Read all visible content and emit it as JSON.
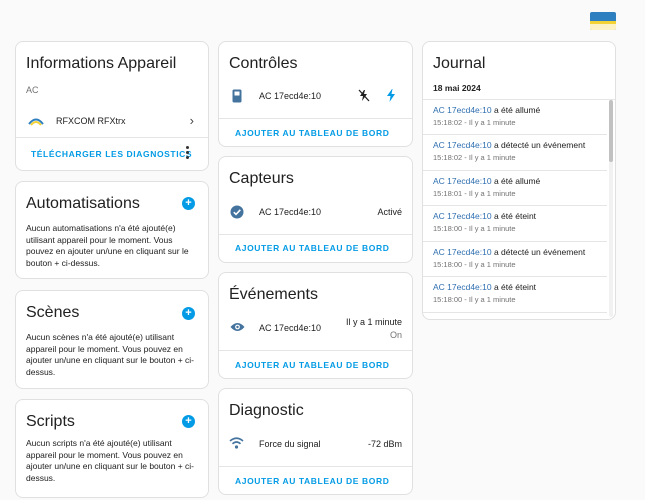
{
  "device_info": {
    "title": "Informations Appareil",
    "subtitle": "AC",
    "integration": "RFXCOM RFXtrx",
    "download_label": "Télécharger les diagnostics"
  },
  "automations": {
    "title": "Automatisations",
    "description": "Aucun automatisations n'a été ajouté(e) utilisant appareil pour le moment. Vous pouvez en ajouter un/une en cliquant sur le bouton + ci-dessus."
  },
  "scenes": {
    "title": "Scènes",
    "description": "Aucun scènes n'a été ajouté(e) utilisant appareil pour le moment. Vous pouvez en ajouter un/une en cliquant sur le bouton + ci-dessus."
  },
  "scripts": {
    "title": "Scripts",
    "description": "Aucun scripts n'a été ajouté(e) utilisant appareil pour le moment. Vous pouvez en ajouter un/une en cliquant sur le bouton + ci-dessus."
  },
  "controls": {
    "title": "Contrôles",
    "entity": "AC 17ecd4e:10",
    "add_label": "Ajouter au tableau de bord"
  },
  "sensors": {
    "title": "Capteurs",
    "entity": "AC 17ecd4e:10",
    "state": "Activé",
    "add_label": "Ajouter au tableau de bord"
  },
  "events": {
    "title": "Événements",
    "entity": "AC 17ecd4e:10",
    "time": "Il y a 1 minute",
    "state": "On",
    "add_label": "Ajouter au tableau de bord"
  },
  "diagnostic": {
    "title": "Diagnostic",
    "entity": "Force du signal",
    "value": "-72 dBm",
    "add_label": "Ajouter au tableau de bord"
  },
  "journal": {
    "title": "Journal",
    "date": "18 mai 2024",
    "entries": [
      {
        "entity": "AC 17ecd4e:10",
        "action": " a été allumé",
        "time": "15:18:02 - Il y a 1 minute"
      },
      {
        "entity": "AC 17ecd4e:10",
        "action": " a détecté un événement",
        "time": "15:18:02 - Il y a 1 minute"
      },
      {
        "entity": "AC 17ecd4e:10",
        "action": " a été allumé",
        "time": "15:18:01 - Il y a 1 minute"
      },
      {
        "entity": "AC 17ecd4e:10",
        "action": " a été éteint",
        "time": "15:18:00 - Il y a 1 minute"
      },
      {
        "entity": "AC 17ecd4e:10",
        "action": " a détecté un événement",
        "time": "15:18:00 - Il y a 1 minute"
      },
      {
        "entity": "AC 17ecd4e:10",
        "action": " a été éteint",
        "time": "15:18:00 - Il y a 1 minute"
      }
    ]
  },
  "icons": {
    "controls_row": "remote-icon",
    "controls_action_off": "flash-off-icon",
    "controls_action_on": "flash-icon",
    "sensors_row": "check-circle-icon",
    "events_row": "eye-icon",
    "diagnostic_row": "wifi-icon"
  },
  "colors": {
    "accent": "#039be5",
    "entity_link": "#2f6fb0"
  }
}
